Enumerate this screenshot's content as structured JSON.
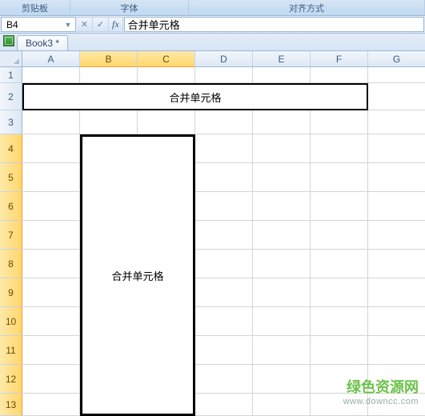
{
  "ribbon": {
    "group_clipboard": "剪贴板",
    "group_font": "字体",
    "group_align": "对齐方式"
  },
  "formula_bar": {
    "name_box": "B4",
    "cancel": "✕",
    "confirm": "✓",
    "fx": "fx",
    "value": "合并单元格"
  },
  "tabs": {
    "doc_name": "Book3 *"
  },
  "columns": [
    "A",
    "B",
    "C",
    "D",
    "E",
    "F",
    "G"
  ],
  "rows": [
    "1",
    "2",
    "3",
    "4",
    "5",
    "6",
    "7",
    "8",
    "9",
    "10",
    "11",
    "12",
    "13"
  ],
  "cells": {
    "merged_h": "合并单元格",
    "merged_v": "合并单元格"
  },
  "watermark": {
    "title": "绿色资源网",
    "url": "www.downcc.com"
  }
}
